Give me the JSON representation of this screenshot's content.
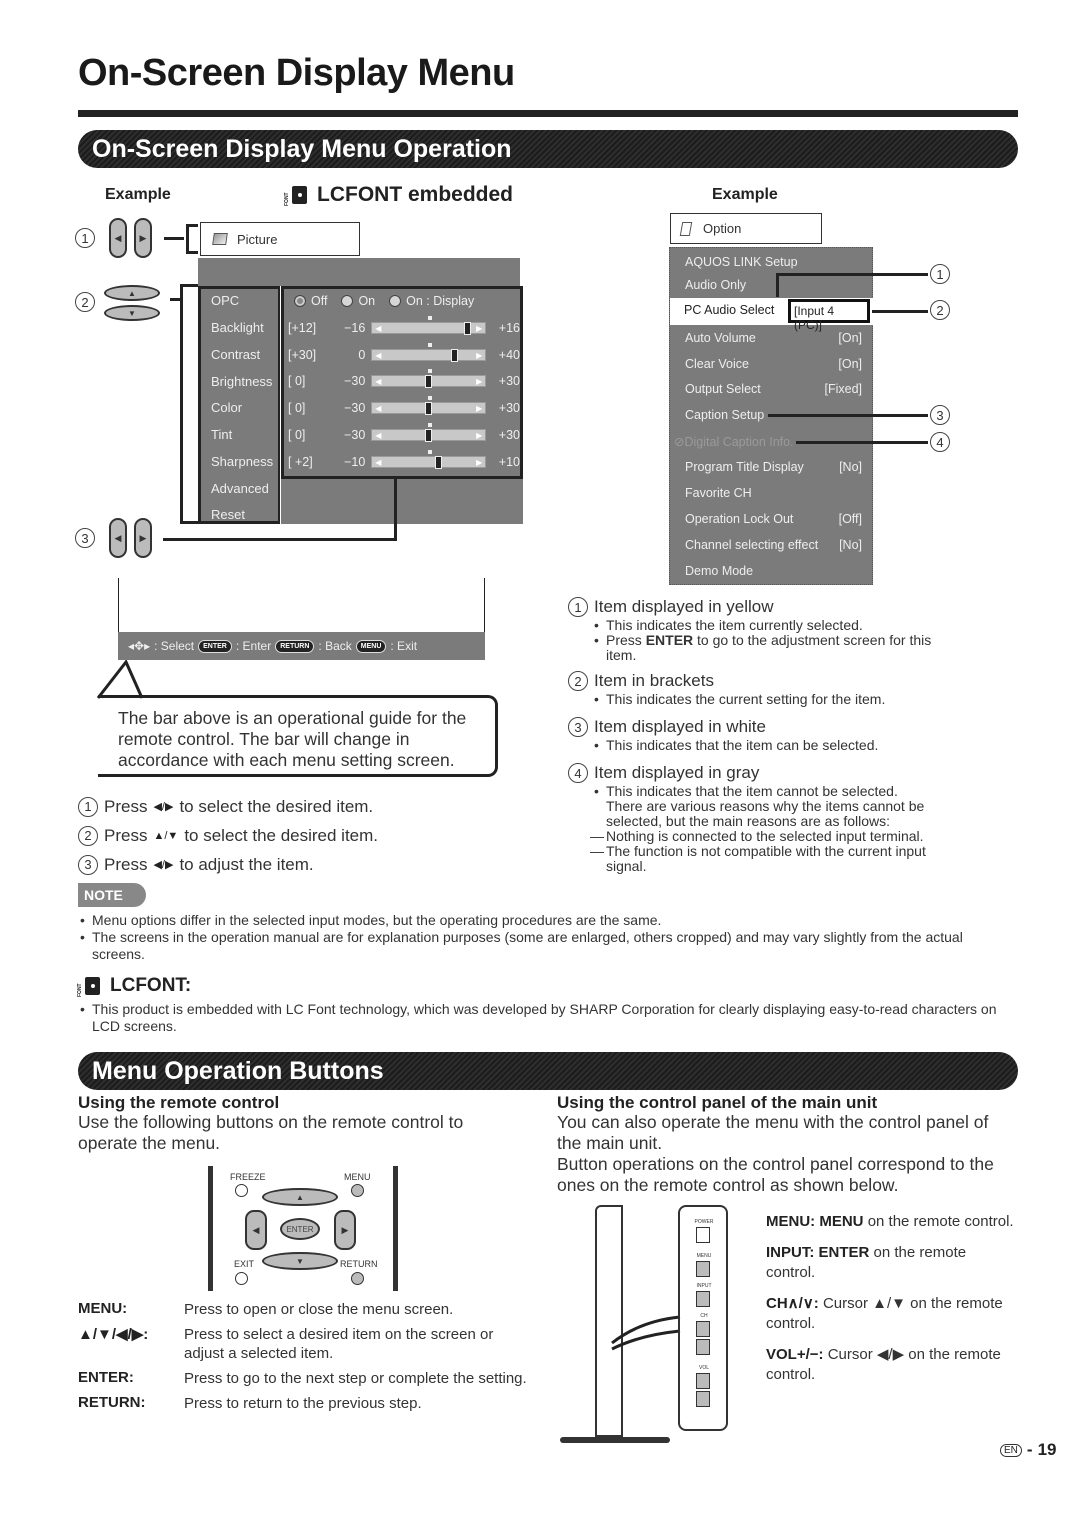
{
  "page": {
    "title": "On-Screen Display Menu",
    "number": "19",
    "lang_badge": "EN",
    "num_sep": "-"
  },
  "section1": {
    "title": "On-Screen Display Menu Operation",
    "example_left": "Example",
    "lcfont_heading": "LCFONT embedded",
    "lcfont_icon_text": "FONT",
    "example_right": "Example",
    "callouts": [
      "1",
      "2",
      "3",
      "4"
    ]
  },
  "picture_menu": {
    "title": "Picture",
    "items": [
      "OPC",
      "Backlight",
      "Contrast",
      "Brightness",
      "Color",
      "Tint",
      "Sharpness",
      "Advanced",
      "Reset"
    ],
    "opc_options": [
      {
        "label": "Off",
        "selected": true
      },
      {
        "label": "On",
        "selected": false
      },
      {
        "label": "On : Display",
        "selected": false
      }
    ],
    "sliders": [
      {
        "name": "Backlight",
        "bracket": "[+12]",
        "min": "−16",
        "max": "+16",
        "value": 12,
        "range": [
          -16,
          16
        ]
      },
      {
        "name": "Contrast",
        "bracket": "[+30]",
        "min": "0",
        "max": "+40",
        "value": 30,
        "range": [
          0,
          40
        ]
      },
      {
        "name": "Brightness",
        "bracket": "[   0]",
        "min": "−30",
        "max": "+30",
        "value": 0,
        "range": [
          -30,
          30
        ]
      },
      {
        "name": "Color",
        "bracket": "[   0]",
        "min": "−30",
        "max": "+30",
        "value": 0,
        "range": [
          -30,
          30
        ]
      },
      {
        "name": "Tint",
        "bracket": "[   0]",
        "min": "−30",
        "max": "+30",
        "value": 0,
        "range": [
          -30,
          30
        ]
      },
      {
        "name": "Sharpness",
        "bracket": "[ +2]",
        "min": "−10",
        "max": "+10",
        "value": 2,
        "range": [
          -10,
          10
        ]
      }
    ]
  },
  "guide_bar": {
    "select": ": Select",
    "enter_key": "ENTER",
    "enter": ": Enter",
    "return_key": "RETURN",
    "back": ": Back",
    "menu_key": "MENU",
    "exit": ": Exit"
  },
  "callout_text": "The bar above is an operational guide for the remote control. The bar will change in accordance with each menu setting screen.",
  "steps": [
    {
      "num": "1",
      "pre": "Press",
      "keys": "◀/▶",
      "post": "to select the desired item."
    },
    {
      "num": "2",
      "pre": "Press",
      "keys": "▲/▼",
      "post": "to select the desired item."
    },
    {
      "num": "3",
      "pre": "Press",
      "keys": "◀/▶",
      "post": "to adjust the item."
    }
  ],
  "option_menu": {
    "title": "Option",
    "items": [
      {
        "label": "AQUOS LINK Setup",
        "value": ""
      },
      {
        "label": "Audio Only",
        "value": ""
      },
      {
        "label": "PC Audio Select",
        "value": "[Input 4 (PC)]",
        "selected": true
      },
      {
        "label": "Auto Volume",
        "value": "[On]"
      },
      {
        "label": "Clear Voice",
        "value": "[On]"
      },
      {
        "label": "Output Select",
        "value": "[Fixed]"
      },
      {
        "label": "Caption Setup",
        "value": ""
      },
      {
        "label": "Digital Caption Info.",
        "value": "",
        "disabled": true
      },
      {
        "label": "Program Title Display",
        "value": "[No]"
      },
      {
        "label": "Favorite CH",
        "value": ""
      },
      {
        "label": "Operation Lock Out",
        "value": "[Off]"
      },
      {
        "label": "Channel selecting effect",
        "value": "[No]"
      },
      {
        "label": "Demo Mode",
        "value": ""
      }
    ]
  },
  "legend": [
    {
      "num": "1",
      "head": "Item displayed in yellow",
      "bullets": [
        "This indicates the item currently selected.",
        "Press ENTER to go to the adjustment screen for this item."
      ]
    },
    {
      "num": "2",
      "head": "Item in brackets",
      "bullets": [
        "This indicates the current setting for the item."
      ]
    },
    {
      "num": "3",
      "head": "Item displayed in white",
      "bullets": [
        "This indicates that the item can be selected."
      ]
    },
    {
      "num": "4",
      "head": "Item displayed in gray",
      "bullets": [
        "This indicates that the item cannot be selected."
      ],
      "cont": [
        "There are various reasons why the items cannot be",
        "selected, but the main reasons are as follows:"
      ],
      "dashes": [
        "Nothing is connected to the selected input terminal.",
        "The function is not compatible with the current input",
        "signal."
      ]
    }
  ],
  "legend_enter_bold": "ENTER",
  "legend_enter_pre": "Press ",
  "legend_enter_post": " to go to the adjustment screen for this",
  "legend_enter_post2": "item.",
  "note": {
    "badge": "NOTE",
    "items": [
      "Menu options differ in the selected input modes, but the operating procedures are the same.",
      "The screens in the operation manual are for explanation purposes (some are enlarged, others cropped) and may vary slightly from the actual screens."
    ]
  },
  "lcfont": {
    "heading": "LCFONT:",
    "text": "This product is embedded with LC Font technology, which was developed by SHARP Corporation for clearly displaying easy-to-read characters on LCD screens."
  },
  "section2": {
    "title": "Menu Operation Buttons",
    "remote_heading": "Using the remote control",
    "remote_text": "Use the following buttons on the remote control to operate the menu.",
    "remote_labels": {
      "freeze": "FREEZE",
      "menu": "MENU",
      "enter": "ENTER",
      "exit": "EXIT",
      "return": "RETURN"
    },
    "defs": [
      {
        "key": "MENU:",
        "val": "Press to open or close the menu screen."
      },
      {
        "key": "▲/▼/◀/▶:",
        "val": "Press to select a desired item on the screen or adjust a selected item."
      },
      {
        "key": "ENTER:",
        "val": "Press to go to the next step or complete the setting."
      },
      {
        "key": "RETURN:",
        "val": "Press to return to the previous step."
      }
    ],
    "panel_heading": "Using the control panel of the main unit",
    "panel_text1": "You can also operate the menu with the control panel of the main unit.",
    "panel_text2": "Button operations on the control panel correspond to the ones on the remote control as shown below.",
    "panel_labels": {
      "power": "POWER",
      "menu": "MENU",
      "input": "INPUT",
      "ch": "CH",
      "vol": "VOL"
    },
    "panel_defs": [
      {
        "key": "MENU:",
        "bold": "MENU",
        "rest": "on the remote control."
      },
      {
        "key": "INPUT:",
        "bold": "ENTER",
        "rest": "on the remote control."
      },
      {
        "key": "CH∧/∨:",
        "bold": "",
        "rest": "Cursor ▲/▼ on the remote control."
      },
      {
        "key": "VOL+/−:",
        "bold": "",
        "rest": "Cursor ◀/▶ on the remote control."
      }
    ]
  }
}
